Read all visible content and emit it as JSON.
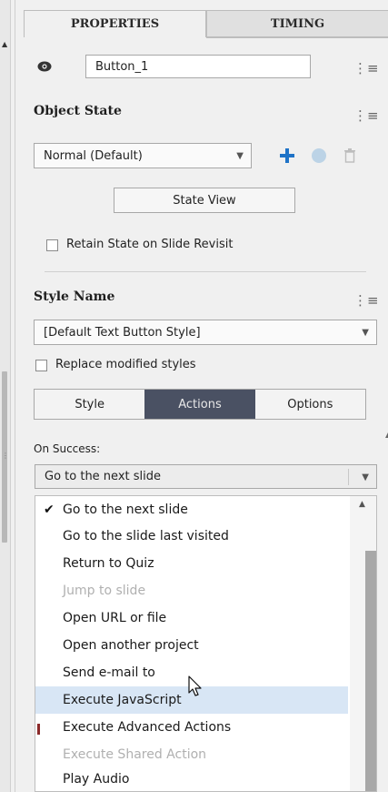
{
  "tabs": [
    {
      "label": "PROPERTIES"
    },
    {
      "label": "TIMING"
    }
  ],
  "object": {
    "name_value": "Button_1"
  },
  "object_state": {
    "title": "Object State",
    "state_value": "Normal (Default)",
    "state_view_label": "State View",
    "retain_label": "Retain State on Slide Revisit"
  },
  "style": {
    "title": "Style Name",
    "style_value": "[Default Text Button Style]",
    "replace_label": "Replace modified styles"
  },
  "segments": [
    {
      "label": "Style"
    },
    {
      "label": "Actions"
    },
    {
      "label": "Options"
    }
  ],
  "actions": {
    "on_success_label": "On Success:",
    "on_success_value": "Go to the next slide",
    "options": [
      {
        "label": "Go to the next slide",
        "checked": true,
        "disabled": false
      },
      {
        "label": "Go to the slide last visited",
        "disabled": false
      },
      {
        "label": "Return to Quiz",
        "disabled": false
      },
      {
        "label": "Jump to slide",
        "disabled": true
      },
      {
        "label": "Open URL or file",
        "disabled": false
      },
      {
        "label": "Open another project",
        "disabled": false
      },
      {
        "label": "Send e-mail to",
        "disabled": false
      },
      {
        "label": "Execute JavaScript",
        "disabled": false,
        "highlighted": true
      },
      {
        "label": "Execute Advanced Actions",
        "disabled": false
      },
      {
        "label": "Execute Shared Action",
        "disabled": true
      },
      {
        "label": "Play Audio",
        "disabled": false
      }
    ]
  },
  "icons": {
    "eye": "eye-icon",
    "menu": "hamburger-menu-icon",
    "plus": "plus-icon",
    "reset": "reset-state-icon",
    "trash": "trash-icon",
    "check": "checkmark-icon",
    "cursor": "mouse-cursor-icon"
  },
  "colors": {
    "accent_blue": "#1f73c7",
    "active_segment": "#4a5163",
    "highlight": "#d8e6f5"
  }
}
